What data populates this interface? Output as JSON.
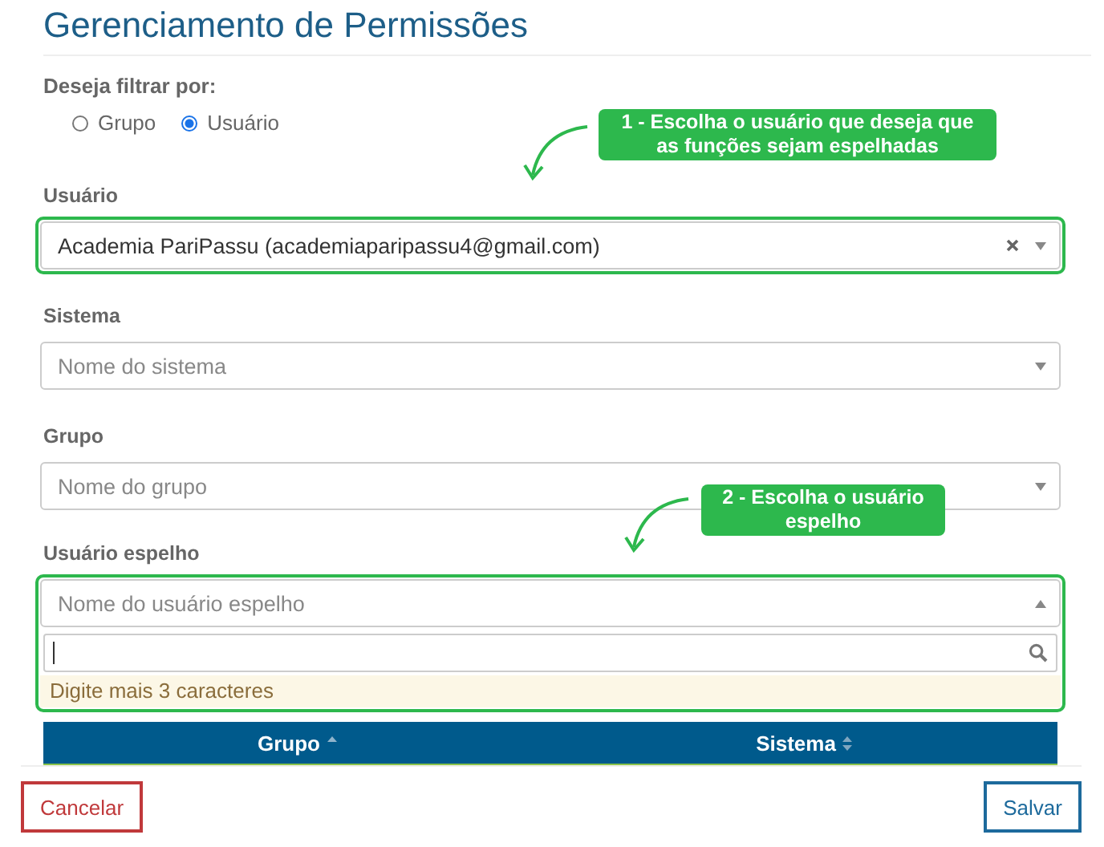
{
  "title": "Gerenciamento de Permissões",
  "filter": {
    "label": "Deseja filtrar por:",
    "options": [
      {
        "label": "Grupo",
        "selected": false
      },
      {
        "label": "Usuário",
        "selected": true
      }
    ]
  },
  "fields": [
    {
      "label": "Usuário",
      "value": "Academia PariPassu (academiaparipassu4@gmail.com)",
      "clearable": true,
      "highlighted": true,
      "expanded": false,
      "callout": "1 - Escolha o usuário que deseja que as funções sejam espelhadas"
    },
    {
      "label": "Sistema",
      "placeholder": "Nome do sistema",
      "clearable": false,
      "highlighted": false,
      "expanded": false
    },
    {
      "label": "Grupo",
      "placeholder": "Nome do grupo",
      "clearable": false,
      "highlighted": false,
      "expanded": false
    },
    {
      "label": "Usuário espelho",
      "placeholder": "Nome do usuário espelho",
      "clearable": false,
      "highlighted": true,
      "expanded": true,
      "message": "Digite mais 3 caracteres",
      "callout": "2 - Escolha o usuário espelho"
    }
  ],
  "table": {
    "columns": [
      {
        "label": "Grupo",
        "sorted": true
      },
      {
        "label": "Sistema",
        "sorted": false
      }
    ]
  },
  "buttons": [
    {
      "label": "Cancelar",
      "kind": "cancel"
    },
    {
      "label": "Salvar",
      "kind": "primary"
    }
  ]
}
